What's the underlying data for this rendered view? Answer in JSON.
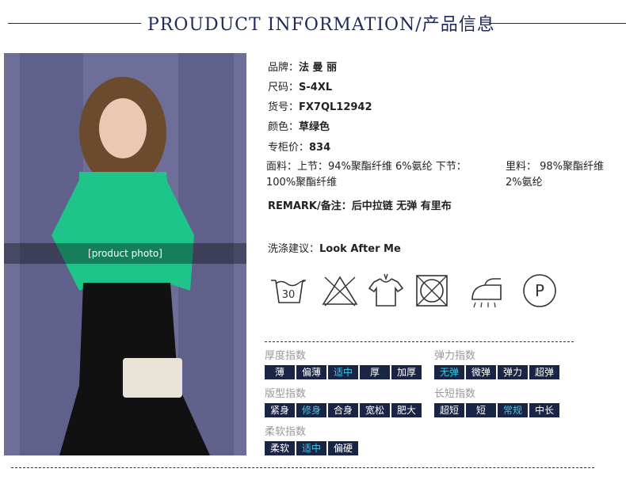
{
  "header": {
    "title": "PROUDUCT INFORMATION/产品信息"
  },
  "photo": {
    "label": "[product photo]"
  },
  "info": {
    "brand_key": "品牌：",
    "brand_val": "法 曼 丽",
    "size_key": "尺码：",
    "size_val": "S-4XL",
    "sku_key": "货号：",
    "sku_val": "FX7QL12942",
    "color_key": "颜色：",
    "color_val": "草绿色",
    "price_key": "专柜价：",
    "price_val": "834",
    "fabric_line1": "面料：上节：94%聚酯纤维 6%氨纶 下节：",
    "fabric_line2": "100%聚酯纤维",
    "lining_line1": "里料：  98%聚酯纤维",
    "lining_line2": "2%氨纶",
    "remark": "REMARK/备注：后中拉链 无弹 有里布",
    "wash_key": "洗涤建议：",
    "wash_val": "Look After Me"
  },
  "care_icons": [
    "wash-30-icon",
    "no-bleach-icon",
    "hang-dry-icon",
    "no-tumble-dry-icon",
    "low-iron-icon",
    "dry-clean-p-icon"
  ],
  "wash_temp": "30",
  "dry_clean_letter": "P",
  "indices": {
    "thickness": {
      "label": "厚度指数",
      "options": [
        "薄",
        "偏薄",
        "适中",
        "厚",
        "加厚"
      ],
      "selected": "适中"
    },
    "elasticity": {
      "label": "弹力指数",
      "options": [
        "无弹",
        "微弹",
        "弹力",
        "超弹"
      ],
      "selected": "无弹"
    },
    "fit": {
      "label": "版型指数",
      "options": [
        "紧身",
        "修身",
        "合身",
        "宽松",
        "肥大"
      ],
      "selected": "修身"
    },
    "length": {
      "label": "长短指数",
      "options": [
        "超短",
        "短",
        "常规",
        "中长"
      ],
      "selected": "常规"
    },
    "softness": {
      "label": "柔软指数",
      "options": [
        "柔软",
        "适中",
        "偏硬"
      ],
      "selected": "适中"
    }
  }
}
